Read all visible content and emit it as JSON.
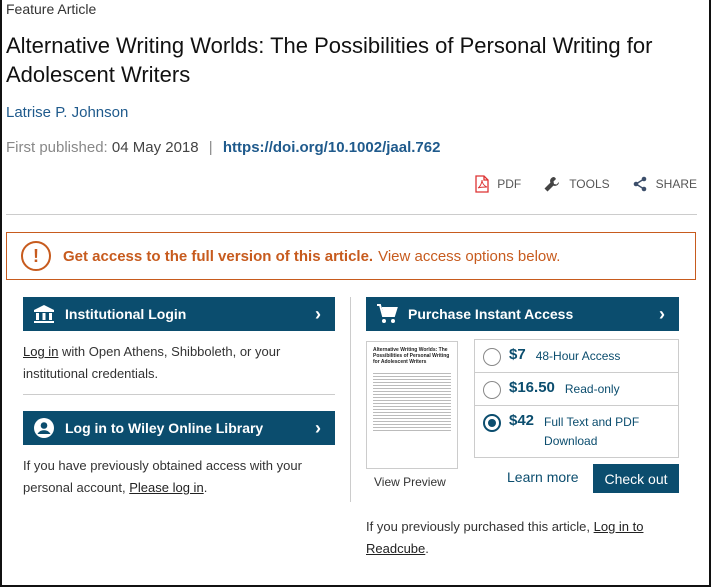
{
  "article": {
    "kicker": "Feature Article",
    "title": "Alternative Writing Worlds: The Possibilities of Personal Writing for Adolescent Writers",
    "author": "Latrise P. Johnson",
    "first_published_label": "First published:",
    "first_published_date": "04 May 2018",
    "separator": "|",
    "doi": "https://doi.org/10.1002/jaal.762"
  },
  "tools": [
    {
      "label": "PDF",
      "icon": "pdf-icon"
    },
    {
      "label": "TOOLS",
      "icon": "wrench-icon"
    },
    {
      "label": "SHARE",
      "icon": "share-icon"
    }
  ],
  "access_banner": {
    "icon": "exclamation-icon",
    "bold_text": "Get access to the full version of this article.",
    "text": "View access options below."
  },
  "institutional": {
    "button_label": "Institutional Login",
    "icon": "institution-icon",
    "para_link": "Log in",
    "para_text": " with Open Athens, Shibboleth, or your institutional credentials."
  },
  "wiley_login": {
    "button_label": "Log in to Wiley Online Library",
    "icon": "user-icon",
    "para_text": "If you have previously obtained access with your personal account, ",
    "para_link": "Please log in",
    "para_end": "."
  },
  "purchase": {
    "button_label": "Purchase Instant Access",
    "icon": "cart-icon",
    "thumb_title": "Alternative Writing Worlds: The Possibilities of Personal Writing for Adolescent Writers",
    "view_preview": "View Preview",
    "options": [
      {
        "price": "$7",
        "label": "48-Hour Access",
        "selected": false
      },
      {
        "price": "$16.50",
        "label": "Read-only",
        "selected": false
      },
      {
        "price": "$42",
        "label": "Full Text and PDF Download",
        "selected": true
      }
    ],
    "learn_more": "Learn more",
    "checkout": "Check out",
    "note_text": "If you previously purchased this article, ",
    "note_link": "Log in to Readcube",
    "note_end": "."
  },
  "colors": {
    "brand_blue": "#0b4d6e",
    "link_blue": "#1f5a8c",
    "alert_orange": "#c75b1e"
  }
}
